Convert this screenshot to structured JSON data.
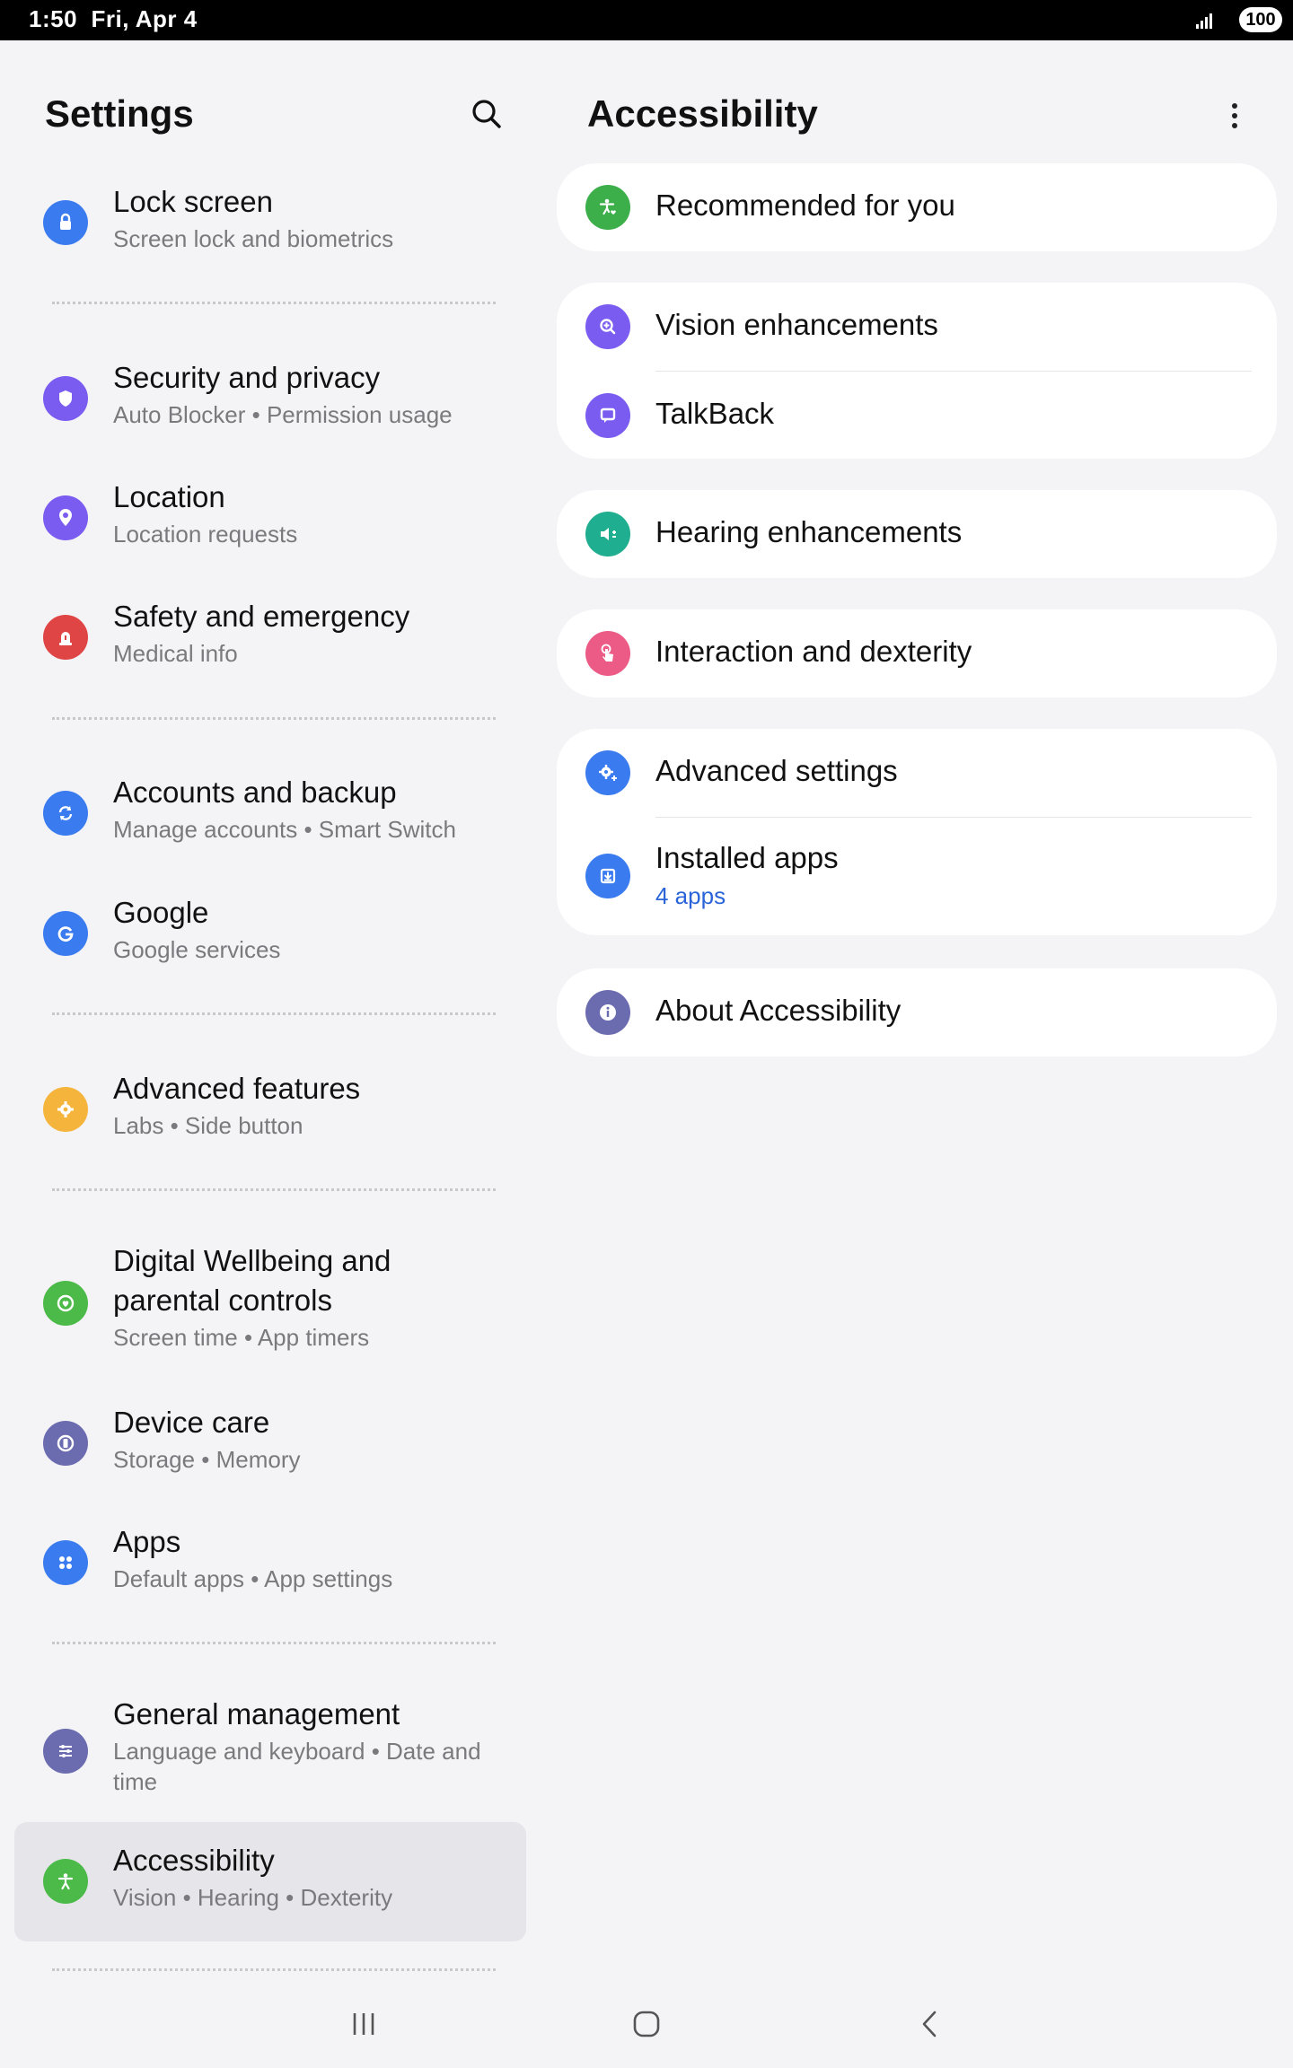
{
  "status_bar": {
    "time": "1:50",
    "date": "Fri, Apr 4",
    "battery": "100"
  },
  "settings": {
    "title": "Settings",
    "items": [
      {
        "title": "Lock screen",
        "subtitle": "Screen lock and biometrics",
        "icon": "lock-icon",
        "color": "#3b7bf0"
      },
      {
        "title": "Security and privacy",
        "subtitle": "Auto Blocker  •  Permission usage",
        "icon": "shield-icon",
        "color": "#7b5cf0"
      },
      {
        "title": "Location",
        "subtitle": "Location requests",
        "icon": "location-pin-icon",
        "color": "#7b5cf0"
      },
      {
        "title": "Safety and emergency",
        "subtitle": "Medical info",
        "icon": "siren-icon",
        "color": "#e04545"
      },
      {
        "title": "Accounts and backup",
        "subtitle": "Manage accounts  •  Smart Switch",
        "icon": "sync-icon",
        "color": "#3b7bf0"
      },
      {
        "title": "Google",
        "subtitle": "Google services",
        "icon": "google-icon",
        "color": "#3b7bf0"
      },
      {
        "title": "Advanced features",
        "subtitle": "Labs  •  Side button",
        "icon": "puzzle-gear-icon",
        "color": "#f5b53d"
      },
      {
        "title": "Digital Wellbeing and",
        "title2": "parental controls",
        "subtitle": "Screen time  •  App timers",
        "icon": "wellbeing-icon",
        "color": "#4cba48"
      },
      {
        "title": "Device care",
        "subtitle": "Storage  •  Memory",
        "icon": "device-care-icon",
        "color": "#6b6bb0"
      },
      {
        "title": "Apps",
        "subtitle": "Default apps  •  App settings",
        "icon": "apps-grid-icon",
        "color": "#3b7bf0"
      },
      {
        "title": "General management",
        "subtitle": "Language and keyboard  •  Date and",
        "subtitle2": "time",
        "icon": "sliders-icon",
        "color": "#6b6bb0"
      },
      {
        "title": "Accessibility",
        "subtitle": "Vision  •  Hearing  •  Dexterity",
        "icon": "accessibility-icon",
        "color": "#4cba48"
      }
    ]
  },
  "accessibility": {
    "title": "Accessibility",
    "recommended": "Recommended for you",
    "vision": "Vision enhancements",
    "talkback": "TalkBack",
    "hearing": "Hearing enhancements",
    "interaction": "Interaction and dexterity",
    "advanced": "Advanced settings",
    "installed": "Installed apps",
    "installed_sub": "4 apps",
    "about": "About Accessibility"
  }
}
